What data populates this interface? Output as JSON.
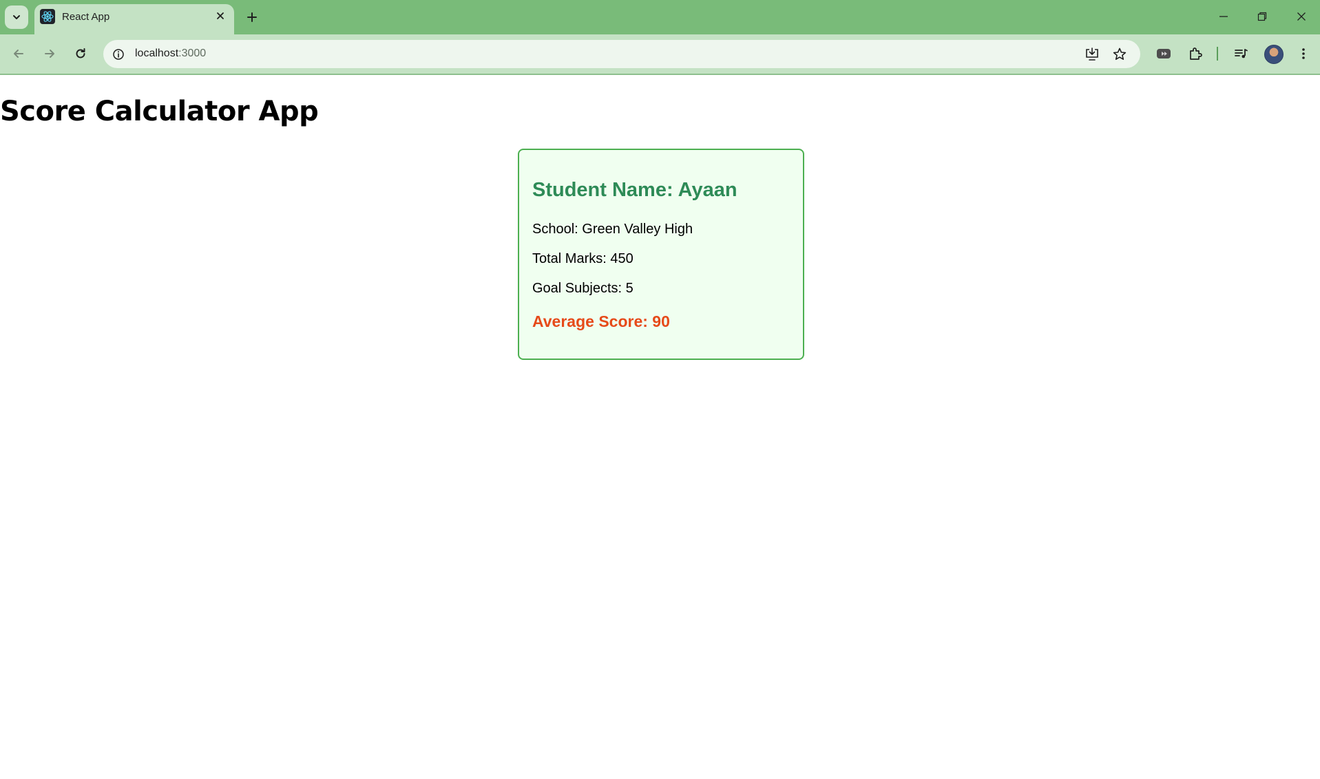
{
  "browser": {
    "tab": {
      "title": "React App"
    },
    "address": {
      "host": "localhost",
      "port": ":3000"
    }
  },
  "page": {
    "title": "Score Calculator App",
    "card": {
      "student_name": "Student Name: Ayaan",
      "school": "School: Green Valley High",
      "total_marks": "Total Marks: 450",
      "goal_subjects": "Goal Subjects: 5",
      "average_score": "Average Score: 90"
    }
  },
  "colors": {
    "chrome_green": "#79bb79",
    "card_border": "#4caf50",
    "card_bg": "#f0fff0",
    "name_color": "#2e8b57",
    "average_color": "#e64a19"
  }
}
